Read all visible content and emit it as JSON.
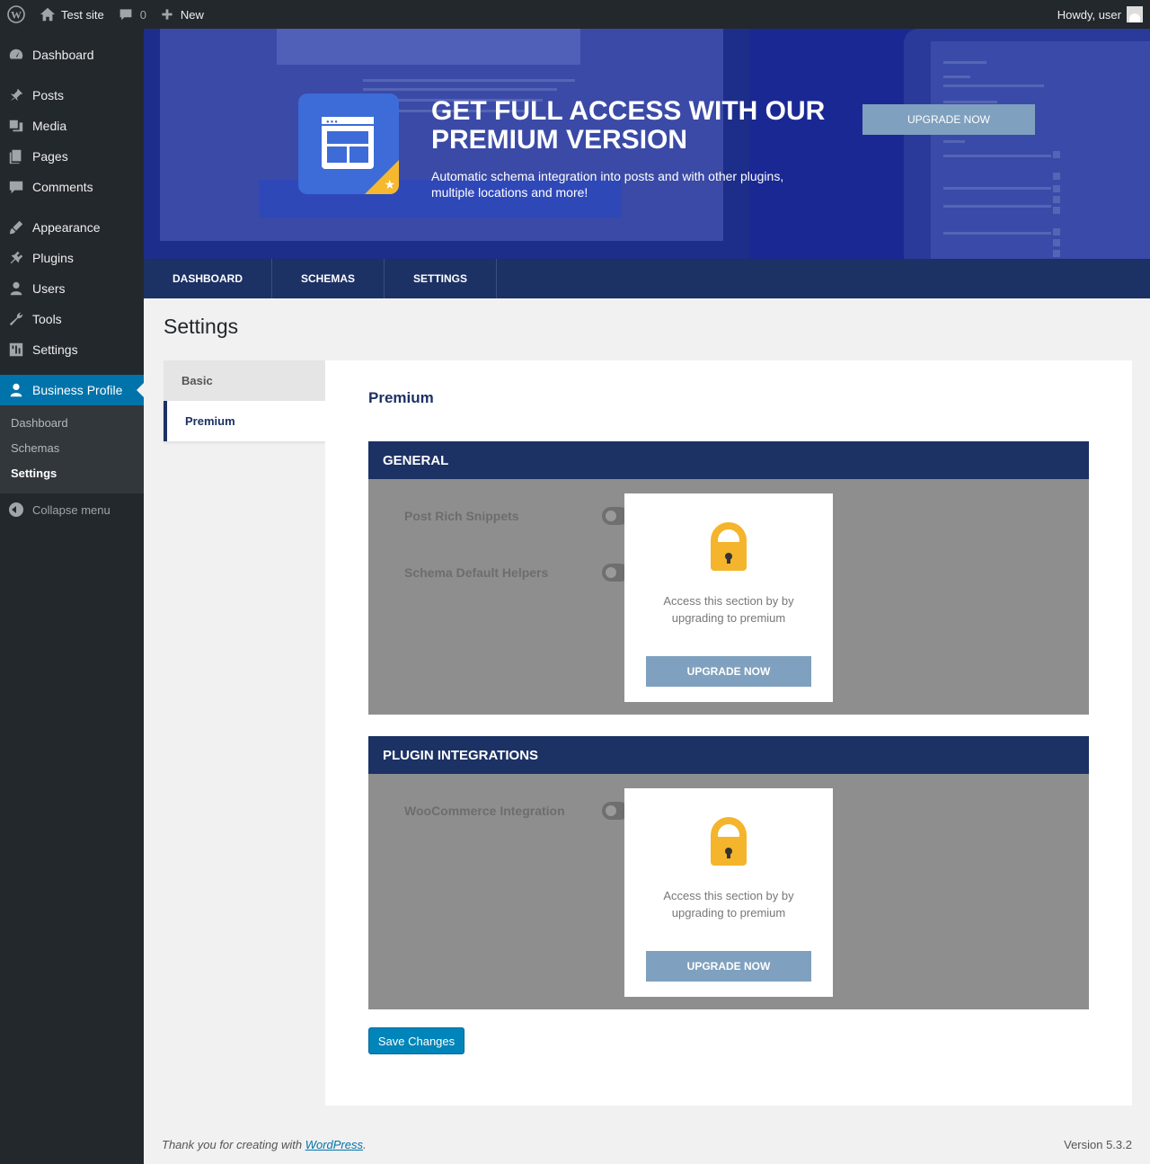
{
  "adminbar": {
    "site_name": "Test site",
    "comments_count": "0",
    "new_label": "New",
    "howdy": "Howdy, user"
  },
  "sidebar": {
    "items": [
      {
        "label": "Dashboard",
        "icon": "dashboard-icon"
      },
      {
        "label": "Posts",
        "icon": "pin-icon"
      },
      {
        "label": "Media",
        "icon": "media-icon"
      },
      {
        "label": "Pages",
        "icon": "pages-icon"
      },
      {
        "label": "Comments",
        "icon": "comment-icon"
      },
      {
        "label": "Appearance",
        "icon": "brush-icon"
      },
      {
        "label": "Plugins",
        "icon": "plug-icon"
      },
      {
        "label": "Users",
        "icon": "users-icon"
      },
      {
        "label": "Tools",
        "icon": "wrench-icon"
      },
      {
        "label": "Settings",
        "icon": "settings-icon"
      },
      {
        "label": "Business Profile",
        "icon": "person-icon"
      }
    ],
    "submenu": [
      "Dashboard",
      "Schemas",
      "Settings"
    ],
    "collapse": "Collapse menu"
  },
  "banner": {
    "title": "GET FULL ACCESS WITH OUR PREMIUM VERSION",
    "description": "Automatic schema integration into posts and with other plugins, multiple locations and more!",
    "button": "UPGRADE NOW"
  },
  "plugin_nav": {
    "tabs": [
      "DASHBOARD",
      "SCHEMAS",
      "SETTINGS"
    ]
  },
  "page": {
    "title": "Settings",
    "side_tabs": [
      "Basic",
      "Premium"
    ],
    "section_heading": "Premium",
    "sections": [
      {
        "heading": "GENERAL",
        "options": [
          "Post Rich Snippets",
          "Schema Default Helpers"
        ]
      },
      {
        "heading": "PLUGIN INTEGRATIONS",
        "options": [
          "WooCommerce Integration"
        ]
      }
    ],
    "lock_text": "Access this section by by upgrading to premium",
    "lock_button": "UPGRADE NOW",
    "save_button": "Save Changes"
  },
  "footer": {
    "thanks_prefix": "Thank you for creating with ",
    "thanks_link": "WordPress",
    "thanks_suffix": ".",
    "version": "Version 5.3.2"
  },
  "colors": {
    "admin_bar": "#23282d",
    "accent": "#0073aa",
    "plugin_nav": "#1c3164",
    "lock": "#f4b42b",
    "upgrade_button": "#7fa0be"
  }
}
